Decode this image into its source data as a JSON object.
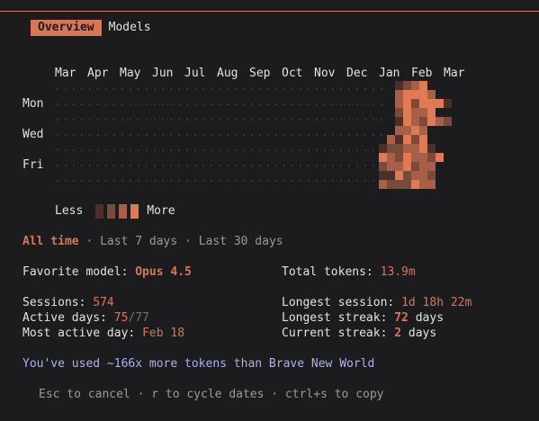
{
  "tabs": [
    {
      "label": "Overview",
      "active": true
    },
    {
      "label": "Models",
      "active": false
    }
  ],
  "heatmap": {
    "months": [
      "Mar",
      "Apr",
      "May",
      "Jun",
      "Jul",
      "Aug",
      "Sep",
      "Oct",
      "Nov",
      "Dec",
      "Jan",
      "Feb",
      "Mar"
    ],
    "day_labels": [
      "Mon",
      "Wed",
      "Fri"
    ],
    "legend_less": "Less",
    "legend_more": "More",
    "colors": [
      "#4a2f2a",
      "#7a4a3b",
      "#a85f48",
      "#e07a55"
    ],
    "empty_dot_color": "#3e3e42"
  },
  "range": {
    "active": "All time",
    "options": [
      "Last 7 days",
      "Last 30 days"
    ],
    "separator": "·"
  },
  "stats": {
    "favorite_model_label": "Favorite model:",
    "favorite_model_value": "Opus 4.5",
    "total_tokens_label": "Total tokens:",
    "total_tokens_value": "13.9m",
    "sessions_label": "Sessions:",
    "sessions_value": "574",
    "active_days_label": "Active days:",
    "active_days_value": "75",
    "active_days_total": "/77",
    "most_active_day_label": "Most active day:",
    "most_active_day_value": "Feb 18",
    "longest_session_label": "Longest session:",
    "longest_session_value": "1d 18h 22m",
    "longest_streak_label": "Longest streak:",
    "longest_streak_value": "72",
    "longest_streak_unit": "days",
    "current_streak_label": "Current streak:",
    "current_streak_value": "2",
    "current_streak_unit": "days"
  },
  "fun_fact": "You've used ~166x more tokens than Brave New World",
  "help": "Esc to cancel · r to cycle dates · ctrl+s to copy"
}
